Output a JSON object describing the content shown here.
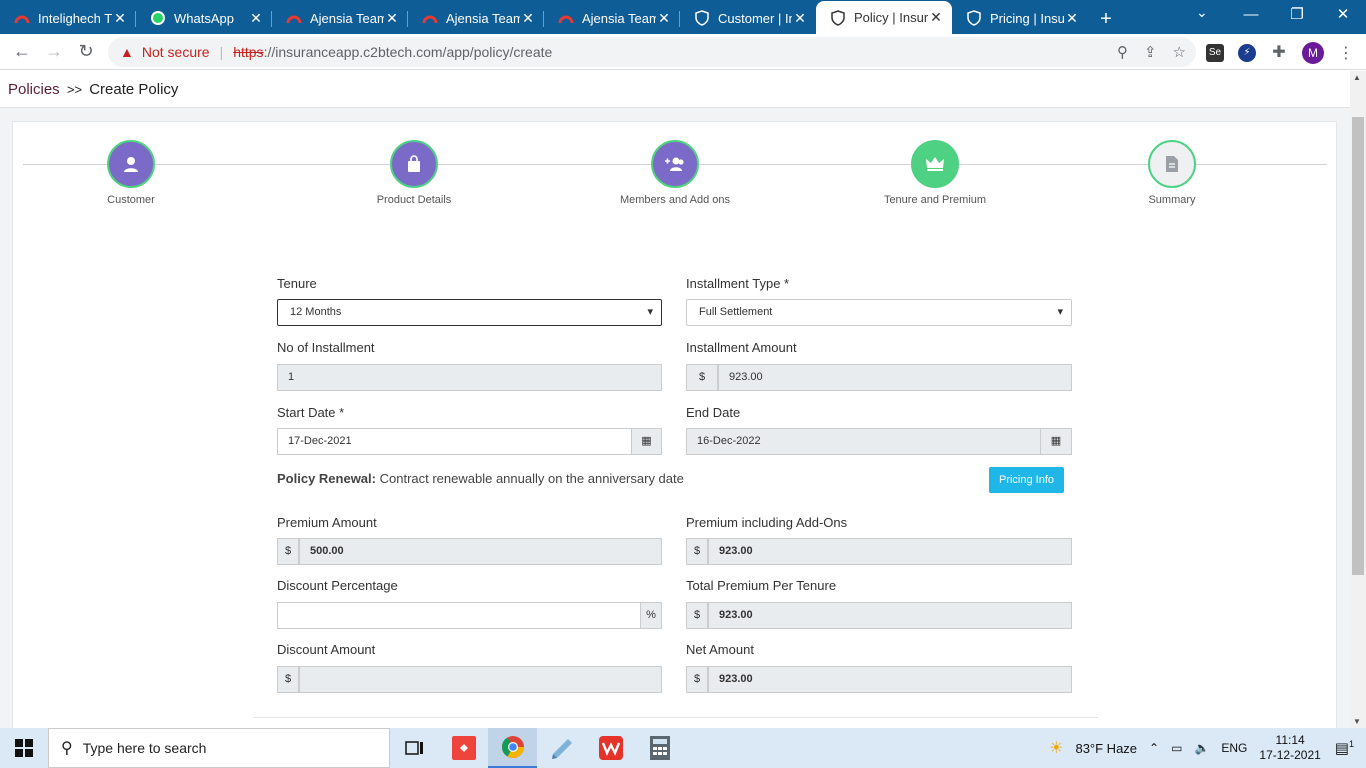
{
  "browser": {
    "tabs": [
      {
        "title": "Intelighech T",
        "favicon": "red-arch-icon",
        "active": false
      },
      {
        "title": "WhatsApp",
        "favicon": "whatsapp-icon",
        "active": false
      },
      {
        "title": "Ajensia Team",
        "favicon": "red-arch-icon",
        "active": false
      },
      {
        "title": "Ajensia Team",
        "favicon": "red-arch-icon",
        "active": false
      },
      {
        "title": "Ajensia Team",
        "favicon": "red-arch-icon",
        "active": false
      },
      {
        "title": "Customer | In",
        "favicon": "shield-icon",
        "active": false
      },
      {
        "title": "Policy | Insura",
        "favicon": "shield-icon",
        "active": true
      },
      {
        "title": "Pricing | Insur",
        "favicon": "shield-icon",
        "active": false
      }
    ],
    "security_label": "Not secure",
    "url_scheme": "https",
    "url_rest": "://insuranceapp.c2btech.com/app/policy/create",
    "profile_initial": "M"
  },
  "page": {
    "breadcrumb_root": "Policies",
    "breadcrumb_sep": ">>",
    "breadcrumb_current": "Create Policy"
  },
  "steps": [
    {
      "label": "Customer",
      "icon": "user-icon",
      "state": "done"
    },
    {
      "label": "Product Details",
      "icon": "bag-icon",
      "state": "done"
    },
    {
      "label": "Members and Add ons",
      "icon": "add-users-icon",
      "state": "done"
    },
    {
      "label": "Tenure and Premium",
      "icon": "crown-icon",
      "state": "current"
    },
    {
      "label": "Summary",
      "icon": "document-icon",
      "state": "pending"
    }
  ],
  "form": {
    "tenure_label": "Tenure",
    "tenure_value": "12 Months",
    "installment_type_label": "Installment Type *",
    "installment_type_value": "Full Settlement",
    "no_installment_label": "No of Installment",
    "no_installment_value": "1",
    "installment_amount_label": "Installment Amount",
    "installment_amount_value": "923.00",
    "start_date_label": "Start Date *",
    "start_date_value": "17-Dec-2021",
    "end_date_label": "End Date",
    "end_date_value": "16-Dec-2022",
    "renewal_title": "Policy Renewal:",
    "renewal_text": "Contract renewable annually on the anniversary date",
    "pricing_info_label": "Pricing Info",
    "premium_amount_label": "Premium Amount",
    "premium_amount_value": "500.00",
    "premium_addons_label": "Premium including Add-Ons",
    "premium_addons_value": "923.00",
    "discount_pct_label": "Discount Percentage",
    "discount_pct_value": "",
    "total_premium_label": "Total Premium Per Tenure",
    "total_premium_value": "923.00",
    "discount_amount_label": "Discount Amount",
    "discount_amount_value": "",
    "net_amount_label": "Net Amount",
    "net_amount_value": "923.00",
    "currency_symbol": "$",
    "percent_symbol": "%"
  },
  "taskbar": {
    "search_placeholder": "Type here to search",
    "weather": "83°F  Haze",
    "language": "ENG",
    "time": "11:14",
    "date": "17-12-2021",
    "notifications": "1"
  },
  "colors": {
    "tabbar": "#0e5d96",
    "step_done": "#7b6ac8",
    "step_current": "#4fd184",
    "pricing_button": "#1fb6e8"
  }
}
